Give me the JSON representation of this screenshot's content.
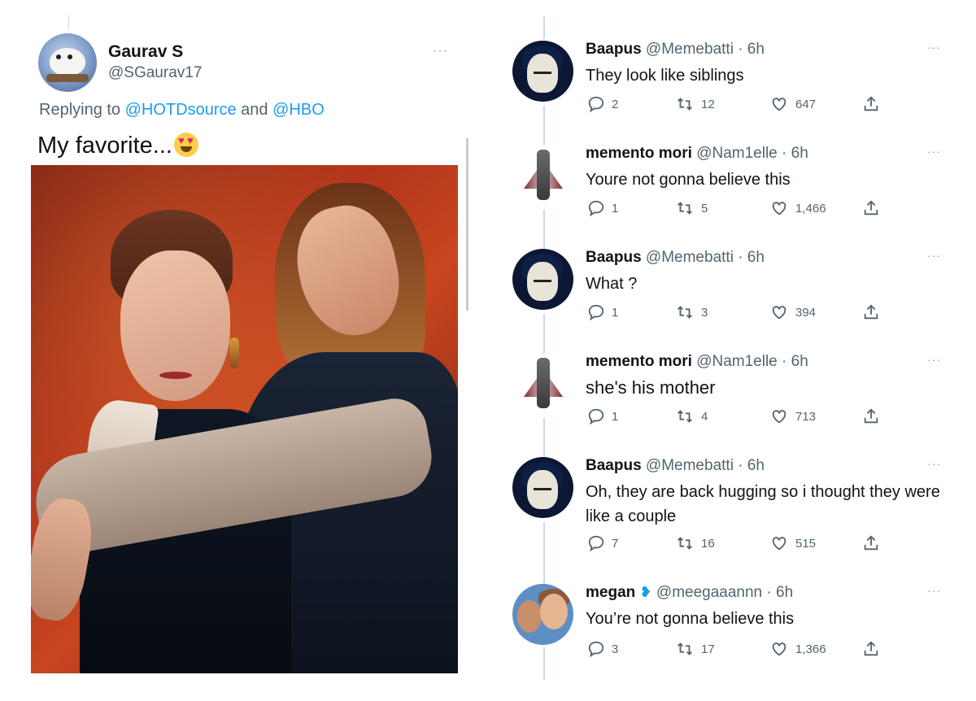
{
  "original_tweet": {
    "author_name": "Gaurav S",
    "author_handle": "@SGaurav17",
    "more_label": "···",
    "replying_prefix": "Replying to ",
    "mention_1": "@HOTDsource",
    "replying_joiner": " and ",
    "mention_2": "@HBO",
    "text": "My favorite...",
    "photo_subject": "two people posing, man hugging woman from behind"
  },
  "replies": [
    {
      "name": "Baapus",
      "handle": "@Memebatti",
      "time": " · 6h",
      "text": "They look like siblings",
      "replies": "2",
      "retweets": "12",
      "likes": "647",
      "avatar": "baapus"
    },
    {
      "name": "memento mori",
      "handle": "@Nam1elle",
      "time": " · 6h",
      "text": "Youre not gonna believe this",
      "replies": "1",
      "retweets": "5",
      "likes": "1,466",
      "avatar": "memento"
    },
    {
      "name": "Baapus",
      "handle": "@Memebatti",
      "time": " · 6h",
      "text": "What ?",
      "replies": "1",
      "retweets": "3",
      "likes": "394",
      "avatar": "baapus"
    },
    {
      "name": "memento mori",
      "handle": "@Nam1elle",
      "time": " · 6h",
      "text": "she's his mother",
      "replies": "1",
      "retweets": "4",
      "likes": "713",
      "avatar": "memento"
    },
    {
      "name": "Baapus",
      "handle": "@Memebatti",
      "time": " · 6h",
      "text": "Oh, they are back hugging so i thought they were like a couple",
      "replies": "7",
      "retweets": "16",
      "likes": "515",
      "avatar": "baapus"
    },
    {
      "name": "megan",
      "handle": "@meegaaannn",
      "time": " · 6h",
      "text": "You’re not gonna believe this",
      "replies": "3",
      "retweets": "17",
      "likes": "1,366",
      "avatar": "megan",
      "badge": "butterfly-icon"
    }
  ],
  "reply_more_label": "···",
  "colors": {
    "link": "#1d9bf0",
    "secondary_text": "#536471",
    "divider": "#cfd9de"
  }
}
